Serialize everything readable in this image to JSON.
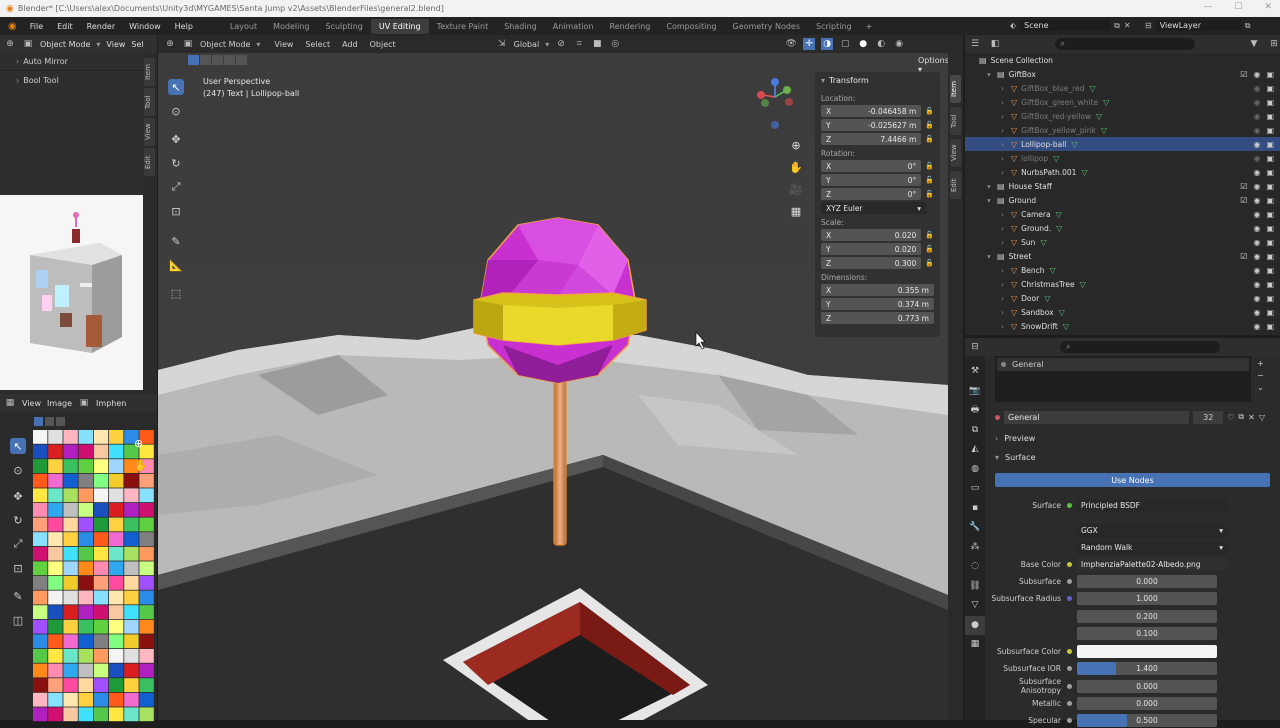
{
  "window": {
    "title": "Blender* [C:\\Users\\alex\\Documents\\Unity3d\\MYGAMES\\Santa Jump v2\\Assets\\BlenderFiles\\general2.blend]"
  },
  "menu": [
    "File",
    "Edit",
    "Render",
    "Window",
    "Help"
  ],
  "workspaces": [
    "Layout",
    "Modeling",
    "Sculpting",
    "UV Editing",
    "Texture Paint",
    "Shading",
    "Animation",
    "Rendering",
    "Compositing",
    "Geometry Nodes",
    "Scripting"
  ],
  "active_workspace": "UV Editing",
  "scene": {
    "label": "Scene",
    "viewlayer": "ViewLayer"
  },
  "left_top": {
    "mode": "Object Mode",
    "view": "View",
    "sel": "Sel",
    "panels": [
      "Auto Mirror",
      "Bool Tool"
    ],
    "tabs": [
      "Item",
      "Tool",
      "View",
      "Edit"
    ]
  },
  "image_editor": {
    "view": "View",
    "image": "Image",
    "name": "Imphen"
  },
  "viewport": {
    "mode": "Object Mode",
    "menus": [
      "View",
      "Select",
      "Add",
      "Object"
    ],
    "orientation": "Global",
    "options": "Options",
    "perspective": "User Perspective",
    "info": "(247) Text | Lollipop-ball",
    "tabs": [
      "Item",
      "Tool",
      "View",
      "Edit"
    ]
  },
  "transform": {
    "title": "Transform",
    "location_label": "Location:",
    "location": [
      {
        "axis": "X",
        "value": "-0.046458 m"
      },
      {
        "axis": "Y",
        "value": "-0.025627 m"
      },
      {
        "axis": "Z",
        "value": "7.4466 m"
      }
    ],
    "rotation_label": "Rotation:",
    "rotation": [
      {
        "axis": "X",
        "value": "0°"
      },
      {
        "axis": "Y",
        "value": "0°"
      },
      {
        "axis": "Z",
        "value": "0°"
      }
    ],
    "rotation_mode": "XYZ Euler",
    "scale_label": "Scale:",
    "scale": [
      {
        "axis": "X",
        "value": "0.020"
      },
      {
        "axis": "Y",
        "value": "0.020"
      },
      {
        "axis": "Z",
        "value": "0.300"
      }
    ],
    "dimensions_label": "Dimensions:",
    "dimensions": [
      {
        "axis": "X",
        "value": "0.355 m"
      },
      {
        "axis": "Y",
        "value": "0.374 m"
      },
      {
        "axis": "Z",
        "value": "0.773 m"
      }
    ]
  },
  "outliner": {
    "root": "Scene Collection",
    "rows": [
      {
        "name": "GiftBox",
        "kind": "collection",
        "indent": 1,
        "dim": false,
        "sel": false
      },
      {
        "name": "GiftBox_blue_red",
        "kind": "object",
        "indent": 2,
        "dim": true,
        "sel": false
      },
      {
        "name": "GiftBox_green_white",
        "kind": "object",
        "indent": 2,
        "dim": true,
        "sel": false
      },
      {
        "name": "GiftBox_red-yellow",
        "kind": "object",
        "indent": 2,
        "dim": true,
        "sel": false
      },
      {
        "name": "GiftBox_yellow_pink",
        "kind": "object",
        "indent": 2,
        "dim": true,
        "sel": false
      },
      {
        "name": "Lollipop-ball",
        "kind": "object",
        "indent": 2,
        "dim": false,
        "sel": true
      },
      {
        "name": "lollipop",
        "kind": "object",
        "indent": 2,
        "dim": true,
        "sel": false
      },
      {
        "name": "NurbsPath.001",
        "kind": "object",
        "indent": 2,
        "dim": false,
        "sel": false
      },
      {
        "name": "House Staff",
        "kind": "collection",
        "indent": 1,
        "dim": false,
        "sel": false
      },
      {
        "name": "Ground",
        "kind": "collection",
        "indent": 1,
        "dim": false,
        "sel": false
      },
      {
        "name": "Camera",
        "kind": "object",
        "indent": 2,
        "dim": false,
        "sel": false
      },
      {
        "name": "Ground.",
        "kind": "object",
        "indent": 2,
        "dim": false,
        "sel": false
      },
      {
        "name": "Sun",
        "kind": "object",
        "indent": 2,
        "dim": false,
        "sel": false
      },
      {
        "name": "Street",
        "kind": "collection",
        "indent": 1,
        "dim": false,
        "sel": false
      },
      {
        "name": "Bench",
        "kind": "object",
        "indent": 2,
        "dim": false,
        "sel": false
      },
      {
        "name": "ChristmasTree",
        "kind": "object",
        "indent": 2,
        "dim": false,
        "sel": false
      },
      {
        "name": "Door",
        "kind": "object",
        "indent": 2,
        "dim": false,
        "sel": false
      },
      {
        "name": "Sandbox",
        "kind": "object",
        "indent": 2,
        "dim": false,
        "sel": false
      },
      {
        "name": "SnowDrift",
        "kind": "object",
        "indent": 2,
        "dim": false,
        "sel": false
      }
    ]
  },
  "properties": {
    "slot": "General",
    "material": "General",
    "users": "32",
    "preview": "Preview",
    "surface_section": "Surface",
    "use_nodes": "Use Nodes",
    "rows": [
      {
        "label": "Surface",
        "value": "Principled BSDF",
        "dot": "#5fbf4a",
        "kind": "text"
      },
      {
        "label": "",
        "value": "GGX",
        "dot": "",
        "kind": "select"
      },
      {
        "label": "",
        "value": "Random Walk",
        "dot": "",
        "kind": "select"
      },
      {
        "label": "Base Color",
        "value": "ImphenziaPalette02-Albedo.png",
        "dot": "#c8c83a",
        "kind": "text"
      },
      {
        "label": "Subsurface",
        "value": "0.000",
        "dot": "#a0a0a0",
        "kind": "num"
      },
      {
        "label": "Subsurface Radius",
        "value": "1.000",
        "dot": "#6363c7",
        "kind": "num"
      },
      {
        "label": "",
        "value": "0.200",
        "dot": "",
        "kind": "num"
      },
      {
        "label": "",
        "value": "0.100",
        "dot": "",
        "kind": "num"
      },
      {
        "label": "Subsurface Color",
        "value": "",
        "dot": "#c8c83a",
        "kind": "color"
      },
      {
        "label": "Subsurface IOR",
        "value": "1.400",
        "dot": "#a0a0a0",
        "kind": "slider"
      },
      {
        "label": "Subsurface Anisotropy",
        "value": "0.000",
        "dot": "#a0a0a0",
        "kind": "num"
      },
      {
        "label": "Metallic",
        "value": "0.000",
        "dot": "#a0a0a0",
        "kind": "num"
      },
      {
        "label": "Specular",
        "value": "0.500",
        "dot": "#a0a0a0",
        "kind": "slider"
      }
    ]
  }
}
